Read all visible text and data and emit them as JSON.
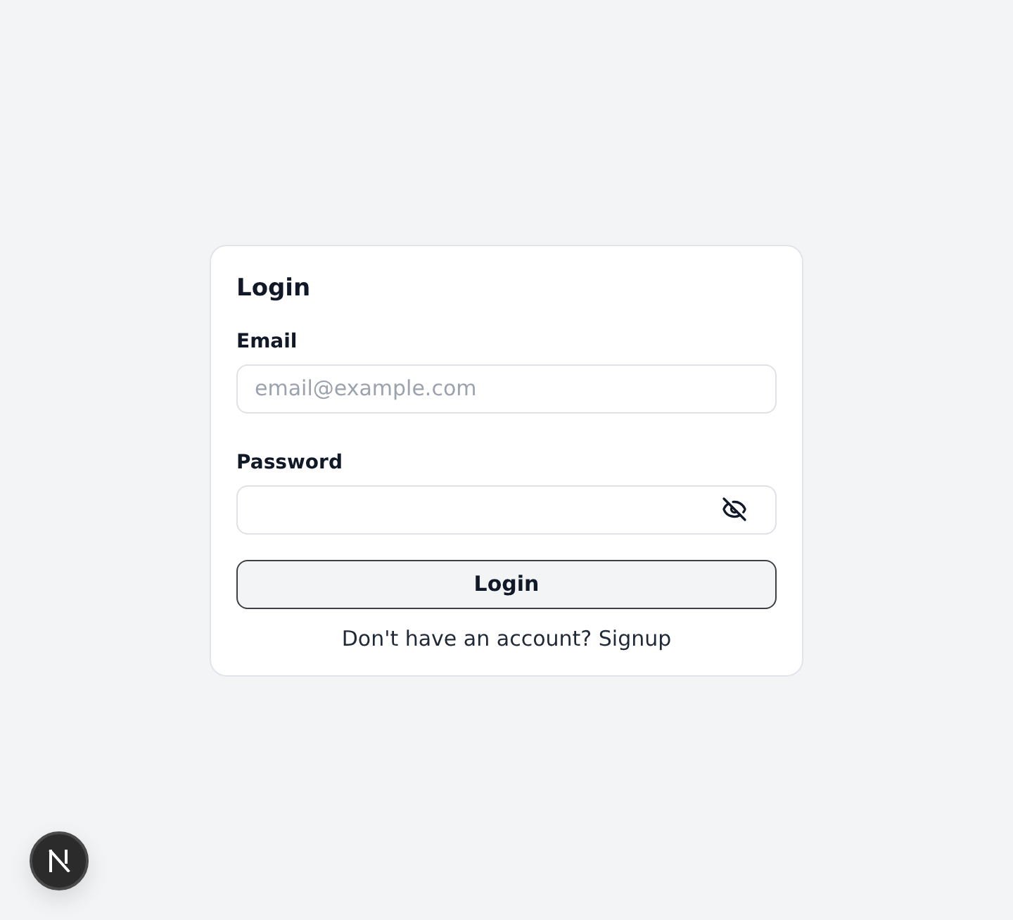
{
  "card": {
    "title": "Login"
  },
  "fields": [
    {
      "kind": "text",
      "label": "Email",
      "placeholder": "email@example.com"
    },
    {
      "kind": "password",
      "label": "Password",
      "revealed": false
    }
  ],
  "submit": {
    "label": "Login"
  },
  "footer": {
    "prompt": "Don't have an account?",
    "link": "Signup"
  }
}
